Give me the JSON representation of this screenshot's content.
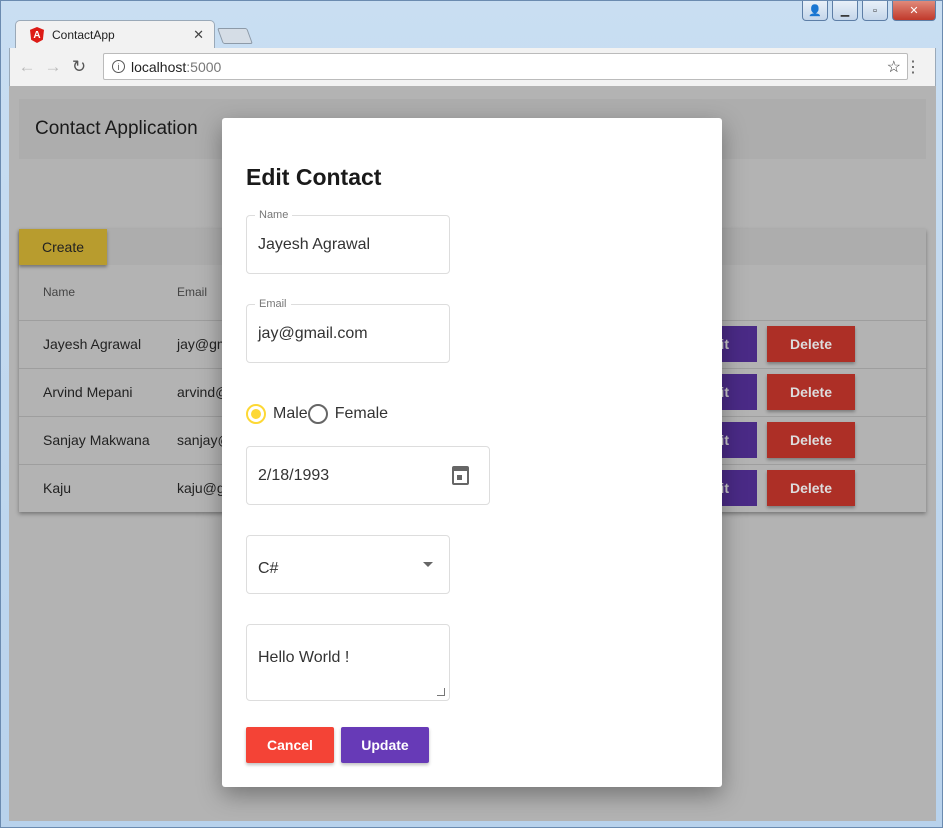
{
  "browser": {
    "tab_title": "ContactApp",
    "url_host": "localhost",
    "url_port": ":5000"
  },
  "app": {
    "title": "Contact Application",
    "create_label": "Create",
    "columns": [
      "Name",
      "Email"
    ],
    "rows": [
      {
        "name": "Jayesh Agrawal",
        "email": "jay@gm",
        "edit": "Edit",
        "delete": "Delete"
      },
      {
        "name": "Arvind Mepani",
        "email": "arvind@",
        "edit": "Edit",
        "delete": "Delete"
      },
      {
        "name": "Sanjay Makwana",
        "email": "sanjay@",
        "edit": "Edit",
        "delete": "Delete"
      },
      {
        "name": "Kaju",
        "email": "kaju@g",
        "edit": "Edit",
        "delete": "Delete"
      }
    ]
  },
  "dialog": {
    "title": "Edit Contact",
    "name_label": "Name",
    "name_value": "Jayesh Agrawal",
    "email_label": "Email",
    "email_value": "jay@gmail.com",
    "gender_options": [
      "Male",
      "Female"
    ],
    "gender_selected": "Male",
    "dob": "2/18/1993",
    "skill": "C#",
    "description": "Hello World !",
    "cancel_label": "Cancel",
    "update_label": "Update"
  },
  "colors": {
    "accent_radio": "#fdd835",
    "cancel": "#f44336",
    "update": "#673ab7",
    "delete": "#ad2f26",
    "create": "#b89c2e"
  }
}
